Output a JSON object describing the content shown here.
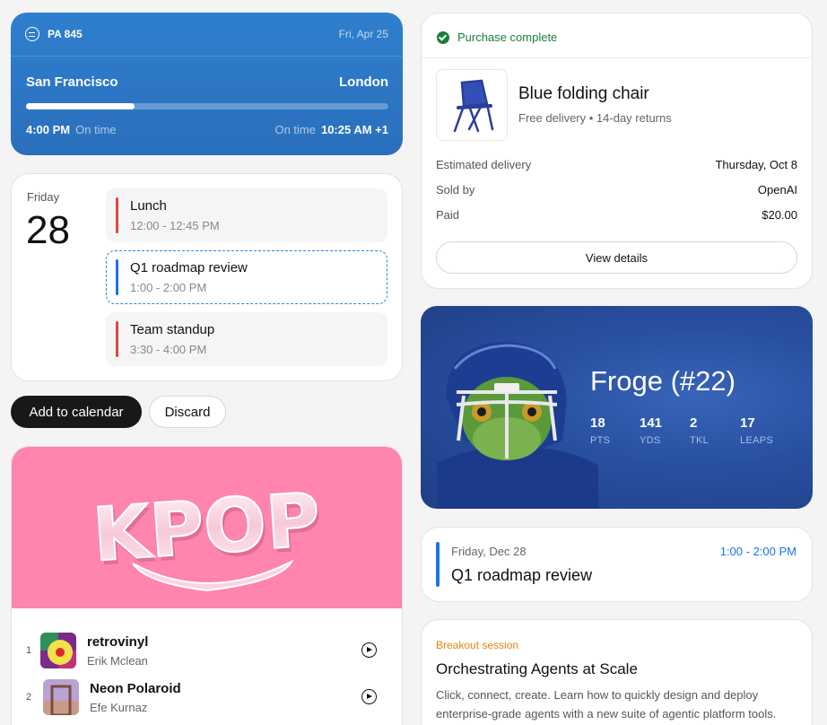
{
  "flight": {
    "code": "PA 845",
    "date": "Fri, Apr 25",
    "origin": "San Francisco",
    "destination": "London",
    "progress": 0.3,
    "depart_time": "4:00 PM",
    "depart_status": "On time",
    "arrive_status": "On time",
    "arrive_time": "10:25 AM +1"
  },
  "calendar": {
    "day_name": "Friday",
    "day_number": "28",
    "events": [
      {
        "title": "Lunch",
        "time": "12:00 - 12:45 PM",
        "color": "#e0443e"
      },
      {
        "title": "Q1 roadmap review",
        "time": "1:00 - 2:00 PM",
        "color": "#1a73e8"
      },
      {
        "title": "Team standup",
        "time": "3:30 - 4:00 PM",
        "color": "#e0443e"
      }
    ],
    "add_label": "Add to calendar",
    "discard_label": "Discard"
  },
  "music": {
    "hero_text": "KPOP",
    "tracks": [
      {
        "index": "1",
        "name": "retrovinyl",
        "artist": "Erik Mclean"
      },
      {
        "index": "2",
        "name": "Neon Polaroid",
        "artist": "Efe Kurnaz"
      }
    ]
  },
  "purchase": {
    "status": "Purchase complete",
    "product_name": "Blue folding chair",
    "product_sub": "Free delivery • 14-day returns",
    "rows": [
      {
        "label": "Estimated delivery",
        "value": "Thursday, Oct 8"
      },
      {
        "label": "Sold by",
        "value": "OpenAI"
      },
      {
        "label": "Paid",
        "value": "$20.00"
      }
    ],
    "details_label": "View details"
  },
  "player": {
    "name": "Froge (#22)",
    "stats": [
      {
        "value": "18",
        "label": "PTS"
      },
      {
        "value": "141",
        "label": "YDS"
      },
      {
        "value": "2",
        "label": "TKL"
      },
      {
        "value": "17",
        "label": "LEAPS"
      }
    ]
  },
  "event": {
    "date": "Friday, Dec 28",
    "time": "1:00 - 2:00 PM",
    "title": "Q1 roadmap review"
  },
  "session": {
    "tag": "Breakout session",
    "title": "Orchestrating Agents at Scale",
    "description": "Click, connect, create. Learn how to quickly design and deploy enterprise-grade agents with a new suite of agentic platform tools."
  }
}
